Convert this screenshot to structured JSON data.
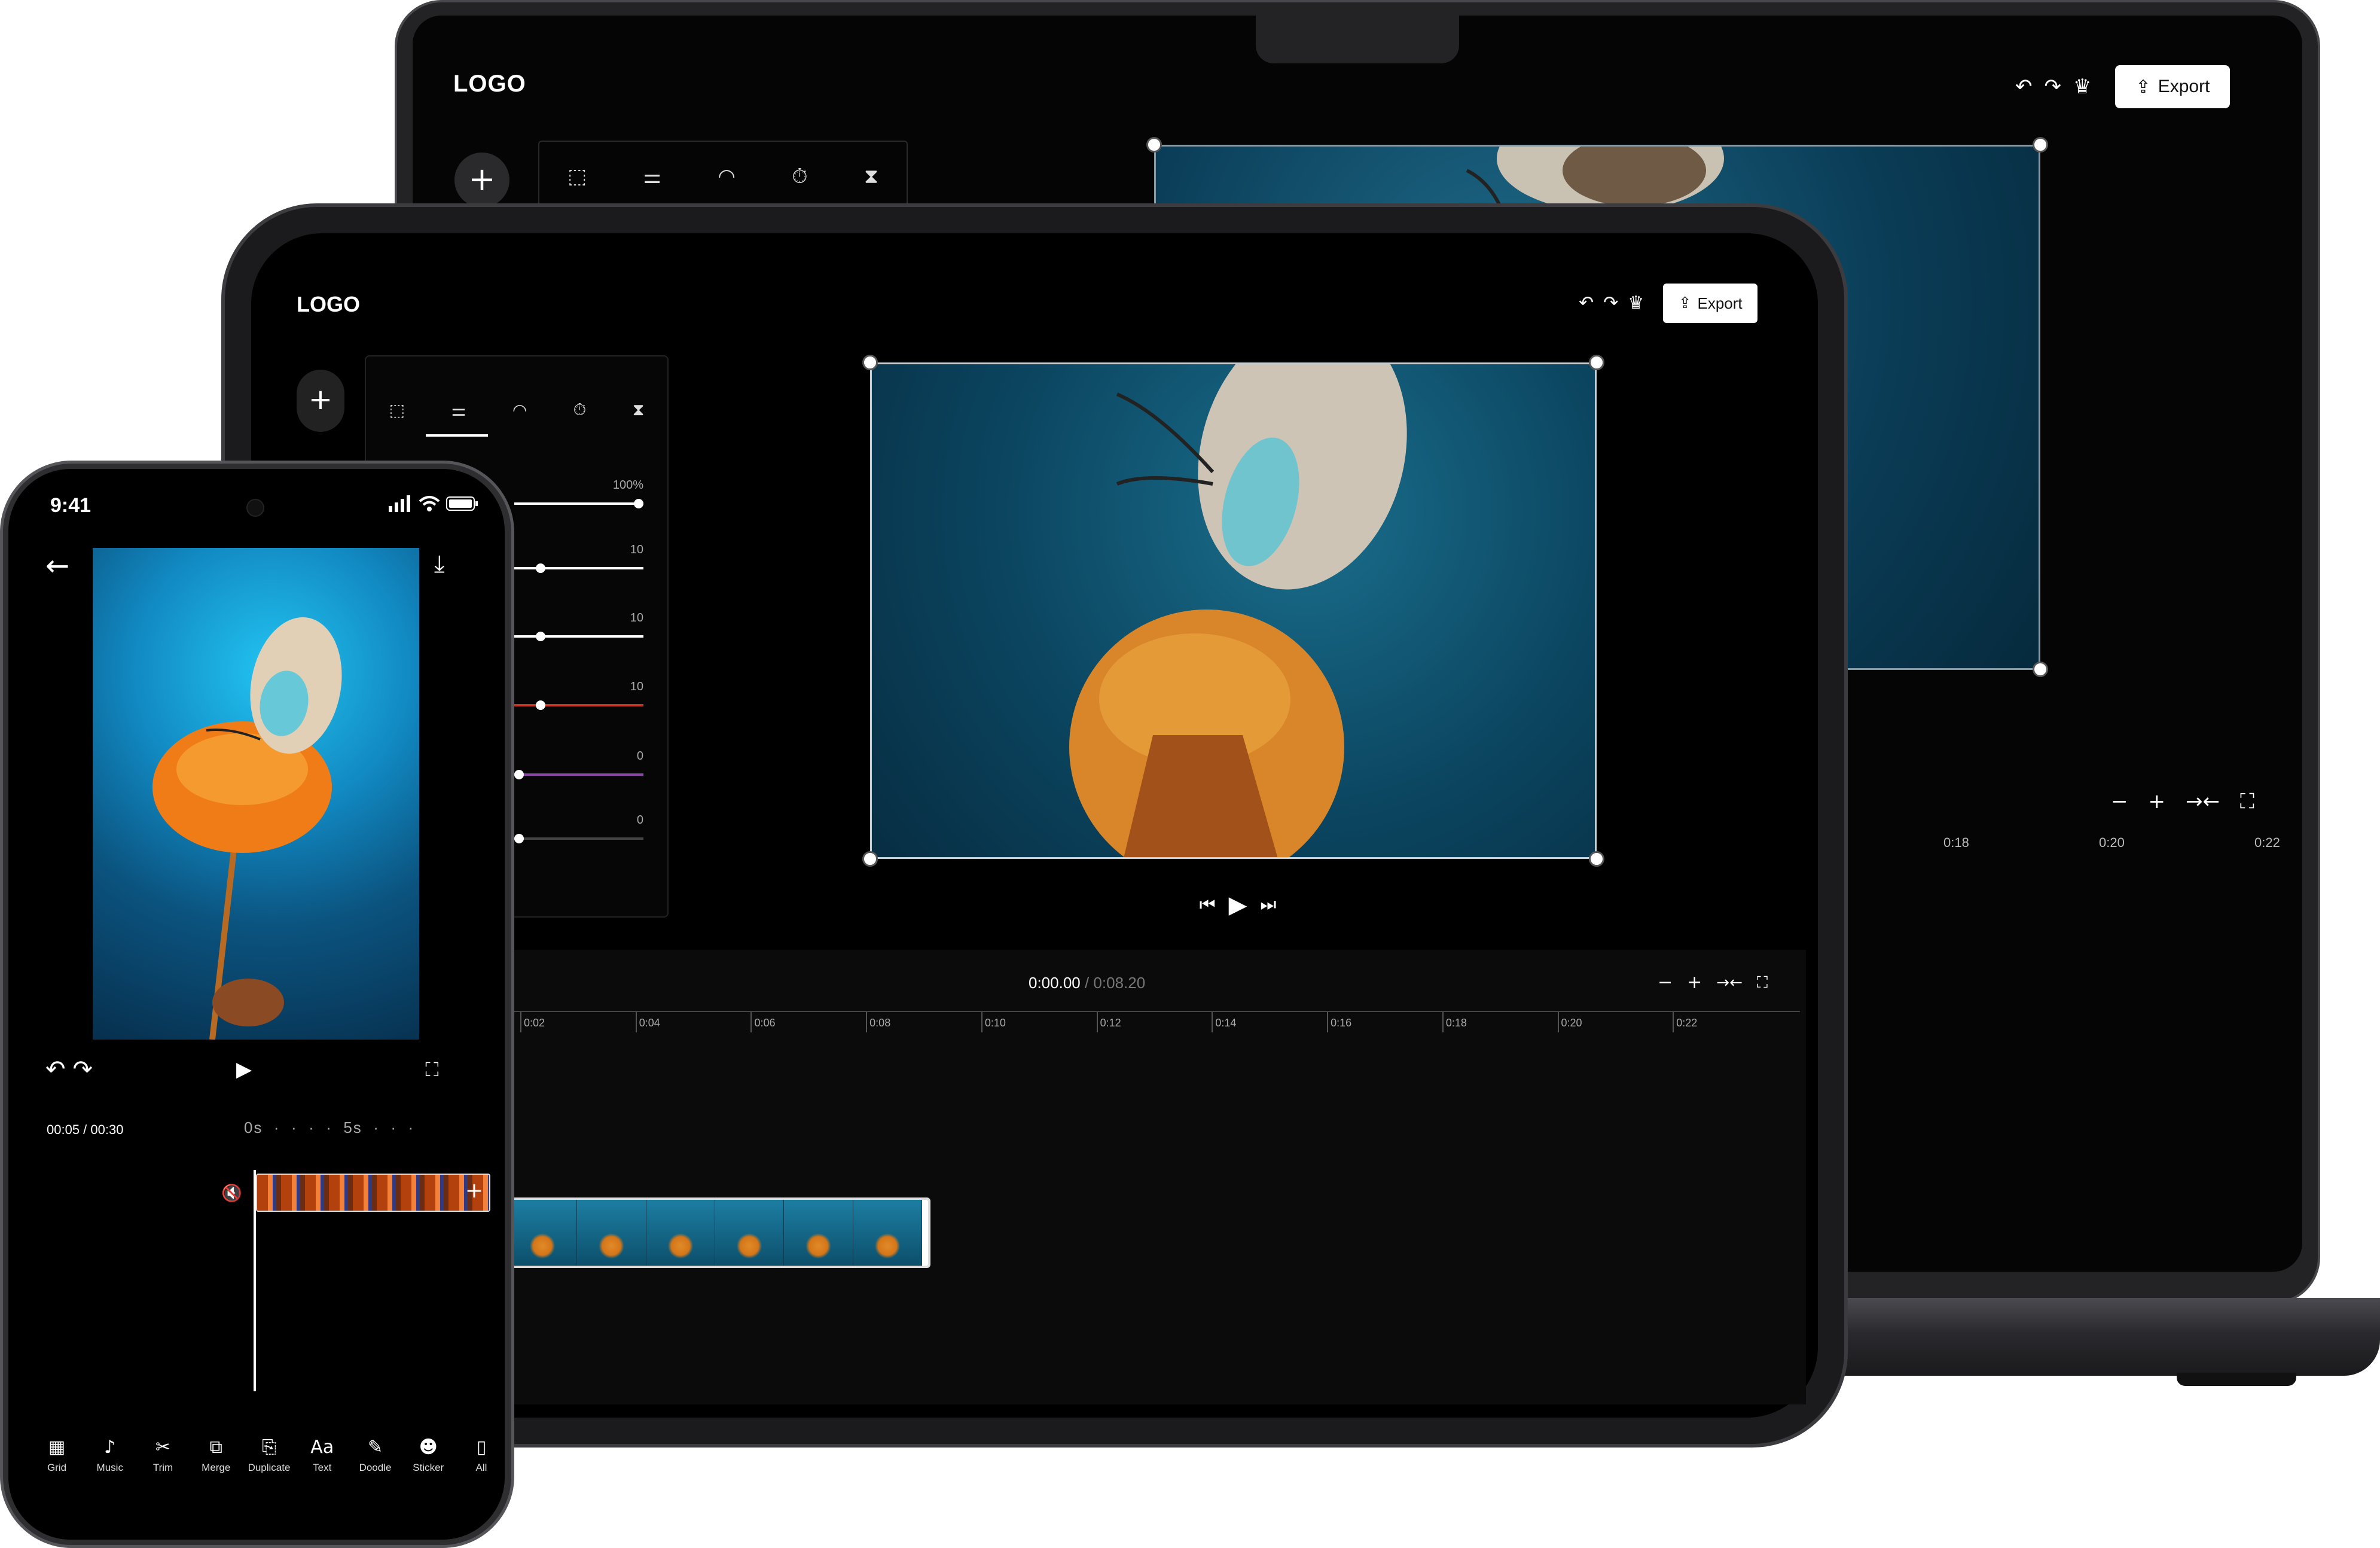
{
  "laptop": {
    "logo": "LOGO",
    "export_label": "Export",
    "icons": [
      "undo-icon",
      "redo-icon",
      "crown-icon",
      "upload-icon"
    ],
    "tools": [
      "crop-icon",
      "adjust-icon",
      "speed-icon",
      "timer-icon",
      "hourglass-icon"
    ],
    "zoom_controls": [
      "−",
      "+",
      "→←",
      "⛶"
    ],
    "ruler_ticks": [
      "0:18",
      "0:20",
      "0:22"
    ]
  },
  "tablet": {
    "logo": "LOGO",
    "export_label": "Export",
    "time_current": "0:00.00",
    "time_sep": " / ",
    "time_total": "0:08.20",
    "sliders": [
      {
        "value": "100%",
        "fill": 1.0,
        "color": "#ffffff"
      },
      {
        "value": "10",
        "fill": 0.1,
        "color": "#ffffff"
      },
      {
        "value": "10",
        "fill": 0.1,
        "color": "#ffffff"
      },
      {
        "value": "10",
        "fill": 0.1,
        "color": "#c0392b"
      },
      {
        "value": "0",
        "fill": 0.0,
        "color": "#8e44ad"
      },
      {
        "value": "0",
        "fill": 0.0,
        "color": "#444444"
      }
    ],
    "ruler_ticks": [
      "0:02",
      "0:04",
      "0:06",
      "0:08",
      "0:10",
      "0:12",
      "0:14",
      "0:16",
      "0:18",
      "0:20",
      "0:22"
    ],
    "zoom_controls": [
      "−",
      "+",
      "→←",
      "⛶"
    ]
  },
  "phone": {
    "clock": "9:41",
    "time_display": "00:05 / 00:30",
    "scale_start": "0s",
    "scale_mid": "5s",
    "toolbar": [
      {
        "label": "Grid",
        "glyph": "▦"
      },
      {
        "label": "Music",
        "glyph": "♪"
      },
      {
        "label": "Trim",
        "glyph": "✂"
      },
      {
        "label": "Merge",
        "glyph": "⧉"
      },
      {
        "label": "Duplicate",
        "glyph": "⎘"
      },
      {
        "label": "Text",
        "glyph": "Aa"
      },
      {
        "label": "Doodle",
        "glyph": "✎"
      },
      {
        "label": "Sticker",
        "glyph": "☻"
      },
      {
        "label": "All",
        "glyph": "▯"
      }
    ]
  }
}
